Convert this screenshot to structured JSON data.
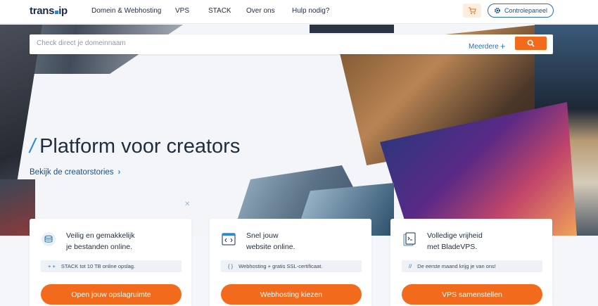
{
  "header": {
    "logo_text_a": "trans",
    "logo_text_b": "ip",
    "nav": [
      "Domein & Webhosting",
      "VPS",
      "STACK",
      "Over ons",
      "Hulp nodig?"
    ],
    "cart_icon": "cart-icon",
    "control_panel_label": "Controlepaneel",
    "control_panel_icon": "gear-icon"
  },
  "search": {
    "placeholder": "Check direct je domeinnaam",
    "more_label": "Meerdere",
    "button_icon": "search-icon"
  },
  "hero": {
    "title": "Platform voor creators",
    "link_label": "Bekijk de creatorstories"
  },
  "cards": [
    {
      "title_line1": "Veilig en gemakkelijk",
      "title_line2": "je bestanden online.",
      "icon": "storage-icon",
      "info_mark": "+ +",
      "info": "STACK tot 10 TB online opslag.",
      "cta": "Open jouw opslagruimte"
    },
    {
      "title_line1": "Snel jouw",
      "title_line2": "website online.",
      "icon": "code-window-icon",
      "info_mark": "{ }",
      "info": "Webhosting + gratis SSL-certificaat.",
      "cta": "Webhosting kiezen"
    },
    {
      "title_line1": "Volledige vrijheid",
      "title_line2": "met BladeVPS.",
      "icon": "terminal-doc-icon",
      "info_mark": "//",
      "info": "De eerste maand krijg je van ons!",
      "cta": "VPS samenstellen"
    }
  ],
  "colors": {
    "accent_orange": "#f26a1b",
    "brand_blue": "#2a8bd5",
    "navy": "#1d2b4a"
  }
}
